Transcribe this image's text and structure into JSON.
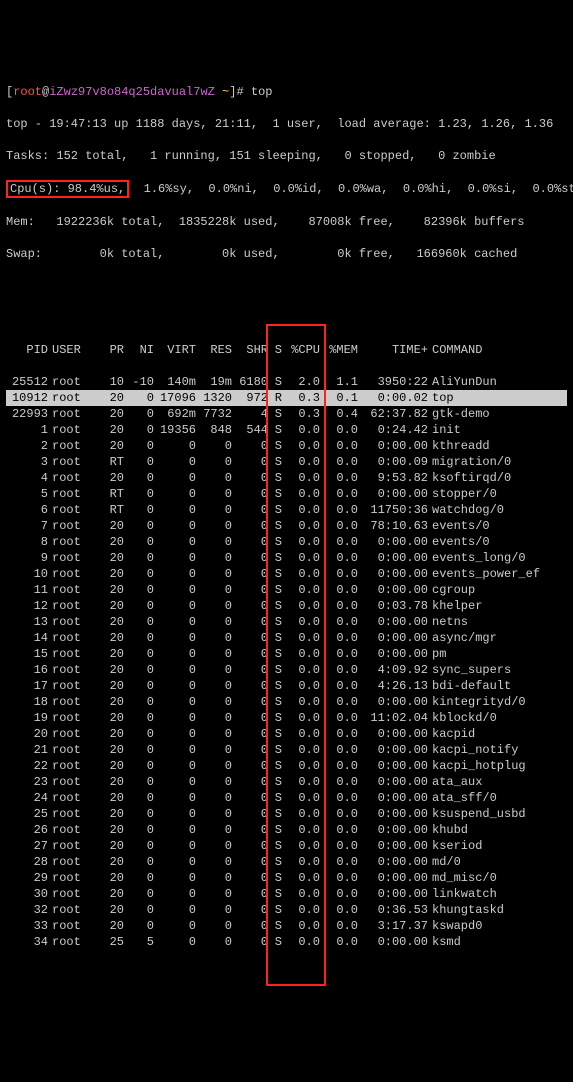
{
  "prompt": {
    "lbr": "[",
    "user": "root",
    "at": "@",
    "host": "iZwz97v8o84q25davual7wZ",
    "path": " ~",
    "rbr": "]# ",
    "cmd": "top"
  },
  "summary": {
    "line1": "top - 19:47:13 up 1188 days, 21:11,  1 user,  load average: 1.23, 1.26, 1.36",
    "line2": "Tasks: 152 total,   1 running, 151 sleeping,   0 stopped,   0 zombie",
    "cpu_hl": "Cpu(s): 98.4%us,",
    "cpu_rest": "  1.6%sy,  0.0%ni,  0.0%id,  0.0%wa,  0.0%hi,  0.0%si,  0.0%st",
    "line4": "Mem:   1922236k total,  1835228k used,    87008k free,    82396k buffers",
    "line5": "Swap:        0k total,        0k used,        0k free,   166960k cached"
  },
  "headers": {
    "pid": "PID",
    "user": "USER",
    "pr": "PR",
    "ni": "NI",
    "virt": "VIRT",
    "res": "RES",
    "shr": "SHR",
    "s": "S",
    "cpu": "%CPU",
    "mem": "%MEM",
    "time": "TIME+",
    "cmd": "COMMAND"
  },
  "rows": [
    {
      "pid": "25512",
      "user": "root",
      "pr": "10",
      "ni": "-10",
      "virt": "140m",
      "res": "19m",
      "shr": "6180",
      "s": "S",
      "cpu": "2.0",
      "mem": "1.1",
      "time": "3950:22",
      "cmd": "AliYunDun",
      "hl": false
    },
    {
      "pid": "10912",
      "user": "root",
      "pr": "20",
      "ni": "0",
      "virt": "17096",
      "res": "1320",
      "shr": "972",
      "s": "R",
      "cpu": "0.3",
      "mem": "0.1",
      "time": "0:00.02",
      "cmd": "top",
      "hl": true
    },
    {
      "pid": "22993",
      "user": "root",
      "pr": "20",
      "ni": "0",
      "virt": "692m",
      "res": "7732",
      "shr": "4",
      "s": "S",
      "cpu": "0.3",
      "mem": "0.4",
      "time": "62:37.82",
      "cmd": "gtk-demo",
      "hl": false
    },
    {
      "pid": "1",
      "user": "root",
      "pr": "20",
      "ni": "0",
      "virt": "19356",
      "res": "848",
      "shr": "544",
      "s": "S",
      "cpu": "0.0",
      "mem": "0.0",
      "time": "0:24.42",
      "cmd": "init",
      "hl": false
    },
    {
      "pid": "2",
      "user": "root",
      "pr": "20",
      "ni": "0",
      "virt": "0",
      "res": "0",
      "shr": "0",
      "s": "S",
      "cpu": "0.0",
      "mem": "0.0",
      "time": "0:00.00",
      "cmd": "kthreadd",
      "hl": false
    },
    {
      "pid": "3",
      "user": "root",
      "pr": "RT",
      "ni": "0",
      "virt": "0",
      "res": "0",
      "shr": "0",
      "s": "S",
      "cpu": "0.0",
      "mem": "0.0",
      "time": "0:00.09",
      "cmd": "migration/0",
      "hl": false
    },
    {
      "pid": "4",
      "user": "root",
      "pr": "20",
      "ni": "0",
      "virt": "0",
      "res": "0",
      "shr": "0",
      "s": "S",
      "cpu": "0.0",
      "mem": "0.0",
      "time": "9:53.82",
      "cmd": "ksoftirqd/0",
      "hl": false
    },
    {
      "pid": "5",
      "user": "root",
      "pr": "RT",
      "ni": "0",
      "virt": "0",
      "res": "0",
      "shr": "0",
      "s": "S",
      "cpu": "0.0",
      "mem": "0.0",
      "time": "0:00.00",
      "cmd": "stopper/0",
      "hl": false
    },
    {
      "pid": "6",
      "user": "root",
      "pr": "RT",
      "ni": "0",
      "virt": "0",
      "res": "0",
      "shr": "0",
      "s": "S",
      "cpu": "0.0",
      "mem": "0.0",
      "time": "11750:36",
      "cmd": "watchdog/0",
      "hl": false
    },
    {
      "pid": "7",
      "user": "root",
      "pr": "20",
      "ni": "0",
      "virt": "0",
      "res": "0",
      "shr": "0",
      "s": "S",
      "cpu": "0.0",
      "mem": "0.0",
      "time": "78:10.63",
      "cmd": "events/0",
      "hl": false
    },
    {
      "pid": "8",
      "user": "root",
      "pr": "20",
      "ni": "0",
      "virt": "0",
      "res": "0",
      "shr": "0",
      "s": "S",
      "cpu": "0.0",
      "mem": "0.0",
      "time": "0:00.00",
      "cmd": "events/0",
      "hl": false
    },
    {
      "pid": "9",
      "user": "root",
      "pr": "20",
      "ni": "0",
      "virt": "0",
      "res": "0",
      "shr": "0",
      "s": "S",
      "cpu": "0.0",
      "mem": "0.0",
      "time": "0:00.00",
      "cmd": "events_long/0",
      "hl": false
    },
    {
      "pid": "10",
      "user": "root",
      "pr": "20",
      "ni": "0",
      "virt": "0",
      "res": "0",
      "shr": "0",
      "s": "S",
      "cpu": "0.0",
      "mem": "0.0",
      "time": "0:00.00",
      "cmd": "events_power_ef",
      "hl": false
    },
    {
      "pid": "11",
      "user": "root",
      "pr": "20",
      "ni": "0",
      "virt": "0",
      "res": "0",
      "shr": "0",
      "s": "S",
      "cpu": "0.0",
      "mem": "0.0",
      "time": "0:00.00",
      "cmd": "cgroup",
      "hl": false
    },
    {
      "pid": "12",
      "user": "root",
      "pr": "20",
      "ni": "0",
      "virt": "0",
      "res": "0",
      "shr": "0",
      "s": "S",
      "cpu": "0.0",
      "mem": "0.0",
      "time": "0:03.78",
      "cmd": "khelper",
      "hl": false
    },
    {
      "pid": "13",
      "user": "root",
      "pr": "20",
      "ni": "0",
      "virt": "0",
      "res": "0",
      "shr": "0",
      "s": "S",
      "cpu": "0.0",
      "mem": "0.0",
      "time": "0:00.00",
      "cmd": "netns",
      "hl": false
    },
    {
      "pid": "14",
      "user": "root",
      "pr": "20",
      "ni": "0",
      "virt": "0",
      "res": "0",
      "shr": "0",
      "s": "S",
      "cpu": "0.0",
      "mem": "0.0",
      "time": "0:00.00",
      "cmd": "async/mgr",
      "hl": false
    },
    {
      "pid": "15",
      "user": "root",
      "pr": "20",
      "ni": "0",
      "virt": "0",
      "res": "0",
      "shr": "0",
      "s": "S",
      "cpu": "0.0",
      "mem": "0.0",
      "time": "0:00.00",
      "cmd": "pm",
      "hl": false
    },
    {
      "pid": "16",
      "user": "root",
      "pr": "20",
      "ni": "0",
      "virt": "0",
      "res": "0",
      "shr": "0",
      "s": "S",
      "cpu": "0.0",
      "mem": "0.0",
      "time": "4:09.92",
      "cmd": "sync_supers",
      "hl": false
    },
    {
      "pid": "17",
      "user": "root",
      "pr": "20",
      "ni": "0",
      "virt": "0",
      "res": "0",
      "shr": "0",
      "s": "S",
      "cpu": "0.0",
      "mem": "0.0",
      "time": "4:26.13",
      "cmd": "bdi-default",
      "hl": false
    },
    {
      "pid": "18",
      "user": "root",
      "pr": "20",
      "ni": "0",
      "virt": "0",
      "res": "0",
      "shr": "0",
      "s": "S",
      "cpu": "0.0",
      "mem": "0.0",
      "time": "0:00.00",
      "cmd": "kintegrityd/0",
      "hl": false
    },
    {
      "pid": "19",
      "user": "root",
      "pr": "20",
      "ni": "0",
      "virt": "0",
      "res": "0",
      "shr": "0",
      "s": "S",
      "cpu": "0.0",
      "mem": "0.0",
      "time": "11:02.04",
      "cmd": "kblockd/0",
      "hl": false
    },
    {
      "pid": "20",
      "user": "root",
      "pr": "20",
      "ni": "0",
      "virt": "0",
      "res": "0",
      "shr": "0",
      "s": "S",
      "cpu": "0.0",
      "mem": "0.0",
      "time": "0:00.00",
      "cmd": "kacpid",
      "hl": false
    },
    {
      "pid": "21",
      "user": "root",
      "pr": "20",
      "ni": "0",
      "virt": "0",
      "res": "0",
      "shr": "0",
      "s": "S",
      "cpu": "0.0",
      "mem": "0.0",
      "time": "0:00.00",
      "cmd": "kacpi_notify",
      "hl": false
    },
    {
      "pid": "22",
      "user": "root",
      "pr": "20",
      "ni": "0",
      "virt": "0",
      "res": "0",
      "shr": "0",
      "s": "S",
      "cpu": "0.0",
      "mem": "0.0",
      "time": "0:00.00",
      "cmd": "kacpi_hotplug",
      "hl": false
    },
    {
      "pid": "23",
      "user": "root",
      "pr": "20",
      "ni": "0",
      "virt": "0",
      "res": "0",
      "shr": "0",
      "s": "S",
      "cpu": "0.0",
      "mem": "0.0",
      "time": "0:00.00",
      "cmd": "ata_aux",
      "hl": false
    },
    {
      "pid": "24",
      "user": "root",
      "pr": "20",
      "ni": "0",
      "virt": "0",
      "res": "0",
      "shr": "0",
      "s": "S",
      "cpu": "0.0",
      "mem": "0.0",
      "time": "0:00.00",
      "cmd": "ata_sff/0",
      "hl": false
    },
    {
      "pid": "25",
      "user": "root",
      "pr": "20",
      "ni": "0",
      "virt": "0",
      "res": "0",
      "shr": "0",
      "s": "S",
      "cpu": "0.0",
      "mem": "0.0",
      "time": "0:00.00",
      "cmd": "ksuspend_usbd",
      "hl": false
    },
    {
      "pid": "26",
      "user": "root",
      "pr": "20",
      "ni": "0",
      "virt": "0",
      "res": "0",
      "shr": "0",
      "s": "S",
      "cpu": "0.0",
      "mem": "0.0",
      "time": "0:00.00",
      "cmd": "khubd",
      "hl": false
    },
    {
      "pid": "27",
      "user": "root",
      "pr": "20",
      "ni": "0",
      "virt": "0",
      "res": "0",
      "shr": "0",
      "s": "S",
      "cpu": "0.0",
      "mem": "0.0",
      "time": "0:00.00",
      "cmd": "kseriod",
      "hl": false
    },
    {
      "pid": "28",
      "user": "root",
      "pr": "20",
      "ni": "0",
      "virt": "0",
      "res": "0",
      "shr": "0",
      "s": "S",
      "cpu": "0.0",
      "mem": "0.0",
      "time": "0:00.00",
      "cmd": "md/0",
      "hl": false
    },
    {
      "pid": "29",
      "user": "root",
      "pr": "20",
      "ni": "0",
      "virt": "0",
      "res": "0",
      "shr": "0",
      "s": "S",
      "cpu": "0.0",
      "mem": "0.0",
      "time": "0:00.00",
      "cmd": "md_misc/0",
      "hl": false
    },
    {
      "pid": "30",
      "user": "root",
      "pr": "20",
      "ni": "0",
      "virt": "0",
      "res": "0",
      "shr": "0",
      "s": "S",
      "cpu": "0.0",
      "mem": "0.0",
      "time": "0:00.00",
      "cmd": "linkwatch",
      "hl": false
    },
    {
      "pid": "32",
      "user": "root",
      "pr": "20",
      "ni": "0",
      "virt": "0",
      "res": "0",
      "shr": "0",
      "s": "S",
      "cpu": "0.0",
      "mem": "0.0",
      "time": "0:36.53",
      "cmd": "khungtaskd",
      "hl": false
    },
    {
      "pid": "33",
      "user": "root",
      "pr": "20",
      "ni": "0",
      "virt": "0",
      "res": "0",
      "shr": "0",
      "s": "S",
      "cpu": "0.0",
      "mem": "0.0",
      "time": "3:17.37",
      "cmd": "kswapd0",
      "hl": false
    },
    {
      "pid": "34",
      "user": "root",
      "pr": "25",
      "ni": "5",
      "virt": "0",
      "res": "0",
      "shr": "0",
      "s": "S",
      "cpu": "0.0",
      "mem": "0.0",
      "time": "0:00.00",
      "cmd": "ksmd",
      "hl": false
    }
  ]
}
